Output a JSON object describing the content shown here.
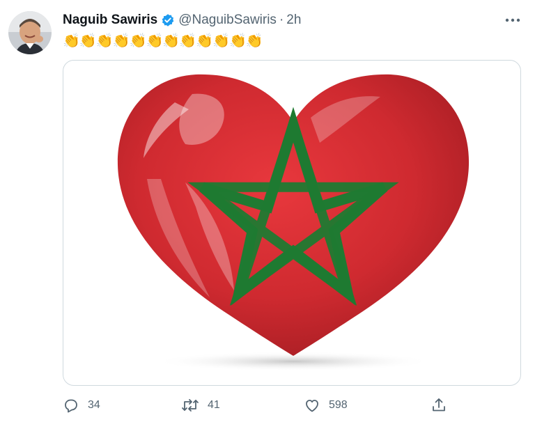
{
  "author": {
    "name": "Naguib Sawiris",
    "handle": "@NaguibSawiris",
    "separator": "·",
    "time": "2h",
    "verified": true
  },
  "tweet": {
    "text": "👏👏👏👏👏👏👏👏👏👏👏👏",
    "media_description": "Red heart with green Moroccan star"
  },
  "actions": {
    "replies": "34",
    "retweets": "41",
    "likes": "598"
  },
  "colors": {
    "verified_blue": "#1d9bf0",
    "flag_red": "#c1272d",
    "flag_green": "#006233",
    "muted_text": "#536471"
  },
  "icons": [
    "reply-icon",
    "retweet-icon",
    "like-icon",
    "share-icon",
    "more-icon",
    "verified-badge-icon"
  ]
}
